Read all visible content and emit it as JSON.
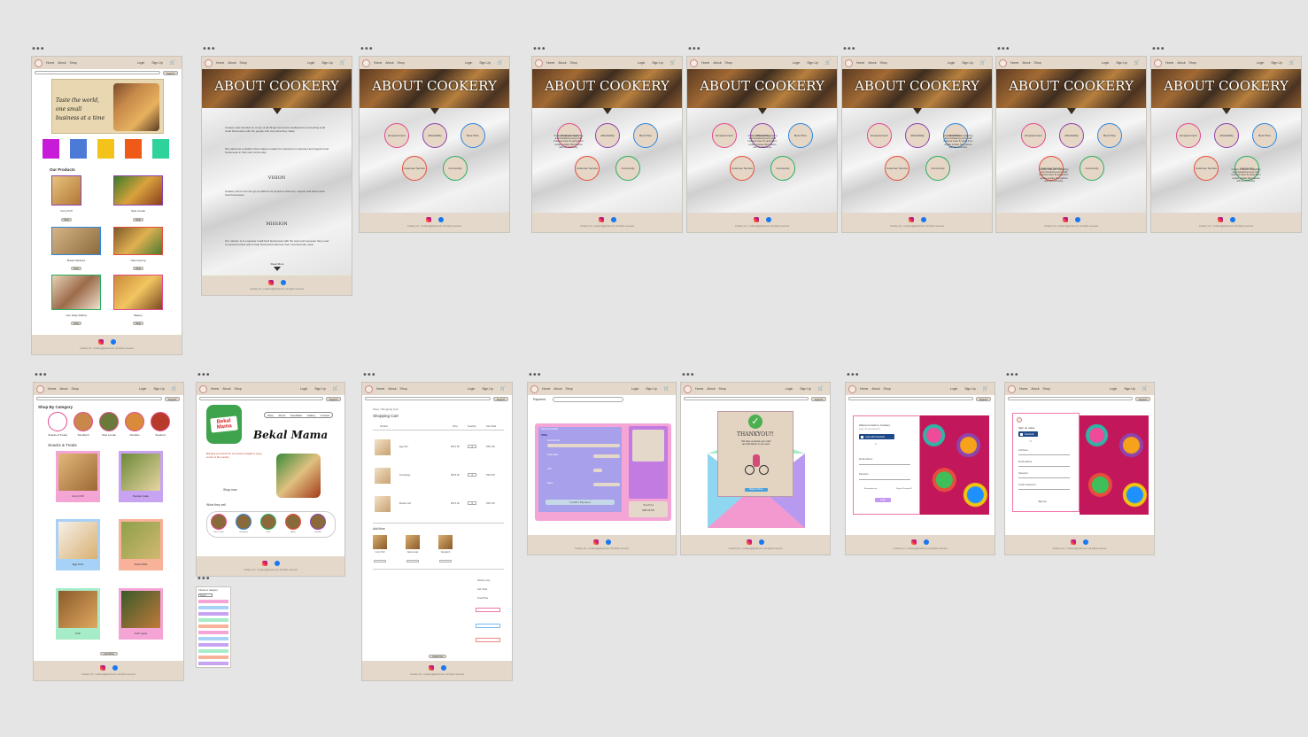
{
  "nav": {
    "home": "Home",
    "about": "About",
    "shop": "Shop",
    "login": "Login",
    "signup": "Sign Up",
    "search_btn": "Search",
    "logo": "Cookery"
  },
  "footer": {
    "copyright": "Cookery Inc. | cookery@gmail.com | All rights reserved"
  },
  "home": {
    "banner_line1": "Taste the world,",
    "banner_line2": "one small",
    "banner_line3": "business at a time",
    "our_products": "Our Products",
    "products": [
      {
        "name": "Curry Puff",
        "btn": "Shop"
      },
      {
        "name": "Nasi Lemak",
        "btn": "Shop"
      },
      {
        "name": "Bread Varieties",
        "btn": "Shop"
      },
      {
        "name": "Nasi Goreng",
        "btn": "Shop"
      },
      {
        "name": "Your Daily Muffins",
        "btn": "Shop"
      },
      {
        "name": "Bakery",
        "btn": "Shop"
      }
    ]
  },
  "about": {
    "title": "ABOUT COOKERY",
    "vision": "VISION",
    "mission": "MISSION",
    "read_more": "Read More",
    "intro": "Cookery was founded on a love of all things food and is dedicated to connecting local small businesses with the people who love what they make.",
    "intro2": "We started as a platform that makes it easier for customers to discover and support food businesses in their own community.",
    "vision_text": "Cookery aims to be the go-to platform for people to discover, support and share local food businesses.",
    "mission_text": "Our mission is to empower small food businesses with the tools and exposure they need to succeed online and to help food lovers discover their next favourite meal.",
    "values": [
      "Empowerment",
      "Affordability",
      "Best Price",
      "Customer Service",
      "Community"
    ],
    "value_desc": "Cookery believes in supporting and empowering every small business owner by giving them a place to share their passion with the community."
  },
  "shop": {
    "category_title": "Shop By Category",
    "categories": [
      "Snacks & Treats",
      "Sandwich",
      "Nasi Lemak",
      "Noodles",
      "Seafood"
    ],
    "section_title": "Snacks & Treats",
    "items": [
      "Curry Puff",
      "Pandan Cake",
      "Egg Tarts",
      "Sushi Rolls",
      "Kuih",
      "Kuih Lapis"
    ],
    "load_more": "Load More"
  },
  "vendor": {
    "brand_logo": "Bekal Mama",
    "brand_title": "Bekal Mama",
    "tabs": [
      "Shop",
      "About",
      "Feedback",
      "Gallery",
      "Contact"
    ],
    "desc": "Bringing you food from our homes straight to every corner of the country.",
    "shop_now": "Shop now",
    "what_we_sell": "What they sell",
    "sell_items": [
      "Nasi Lemak",
      "Rendang",
      "Kuih",
      "Ayam",
      "Sambal"
    ]
  },
  "dropdown": {
    "title": "Choose a category",
    "placeholder": "Select"
  },
  "cart": {
    "breadcrumb": "Shop / Shopping Cart",
    "title": "Shopping Cart",
    "columns": [
      "Product",
      "Price",
      "Quantity",
      "Sub-Total"
    ],
    "rows": [
      {
        "name": "Egg Tart",
        "price": "RM 2.50",
        "qty": "1",
        "subtotal": "RM 2.50"
      },
      {
        "name": "Dumplings",
        "price": "RM 8.00",
        "qty": "1",
        "subtotal": "RM 8.00"
      },
      {
        "name": "Bread Loaf",
        "price": "RM 5.00",
        "qty": "1",
        "subtotal": "RM 5.00"
      }
    ],
    "add_more": "Add More",
    "suggest": [
      "Curry Puff",
      "Nasi Lemak",
      "Sandwich"
    ],
    "summary": [
      "Delivery Fee",
      "Sub-Total",
      "Total Price"
    ],
    "checkout": "Check Out"
  },
  "payment": {
    "title": "Payment",
    "method": "Payment Details",
    "card_label": "VISA",
    "card_num_label": "Card Number",
    "expiry": "Expiry Date",
    "cvv": "CVV",
    "name": "Name",
    "confirm_btn": "Confirm Payment",
    "total_label": "Total Price",
    "total_value": "RM 15.50"
  },
  "thanks": {
    "title": "THANKYOU!!",
    "message": "We have received your order and will deliver to you soon.",
    "btn": "Back to Home"
  },
  "login": {
    "welcome": "Welcome back to Cookery",
    "sub": "Log in to your account",
    "facebook_btn": "Login with Facebook",
    "or": "Or",
    "email": "Email Address",
    "password": "Password",
    "remember": "Remember me",
    "forgot": "Forgot Password?",
    "submit": "Login"
  },
  "signup": {
    "title": "Sign up today",
    "facebook_btn": "Facebook",
    "or": "Or",
    "name": "Full Name",
    "email": "Email Address",
    "password": "Password",
    "confirm": "Confirm Password",
    "submit": "Sign Up"
  },
  "colors": {
    "nav_bg": "#e3d8c9",
    "canvas_bg": "#e5e5e5",
    "accent_pink": "#e24a8d",
    "accent_purple": "#8e44ad"
  }
}
